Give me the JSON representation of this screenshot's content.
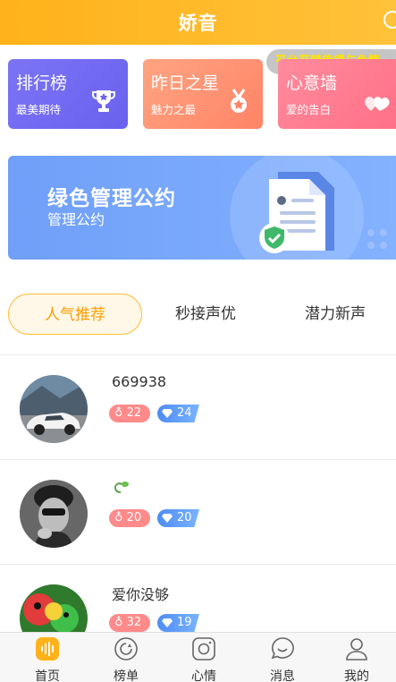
{
  "header": {
    "title": "娇音"
  },
  "notice": {
    "text": "平台严禁传播与色情"
  },
  "cards": [
    {
      "title": "排行榜",
      "subtitle": "最美期待",
      "icon": "trophy-icon"
    },
    {
      "title": "昨日之星",
      "subtitle": "魅力之最",
      "icon": "medal-icon"
    },
    {
      "title": "心意墙",
      "subtitle": "爱的告白",
      "icon": "hearts-icon"
    }
  ],
  "banner": {
    "title": "绿色管理公约",
    "subtitle": "管理公约",
    "icon": "document-shield-icon"
  },
  "tabs": [
    {
      "label": "人气推荐",
      "active": true
    },
    {
      "label": "秒接声优",
      "active": false
    },
    {
      "label": "潜力新声",
      "active": false
    }
  ],
  "users": [
    {
      "name": "669938",
      "charm": "22",
      "wealth": "24"
    },
    {
      "name": "",
      "charm": "20",
      "wealth": "20"
    },
    {
      "name": "爱你没够",
      "charm": "32",
      "wealth": "19"
    }
  ],
  "bottom_nav": [
    {
      "label": "首页",
      "icon": "home-sound-icon",
      "active": true
    },
    {
      "label": "榜单",
      "icon": "ranking-icon",
      "active": false
    },
    {
      "label": "心情",
      "icon": "camera-icon",
      "active": false
    },
    {
      "label": "消息",
      "icon": "message-icon",
      "active": false
    },
    {
      "label": "我的",
      "icon": "profile-icon",
      "active": false
    }
  ],
  "colors": {
    "accent": "#ffb21a",
    "charm_badge": "#ff8a8a",
    "wealth_badge": "#4d8cf5"
  }
}
